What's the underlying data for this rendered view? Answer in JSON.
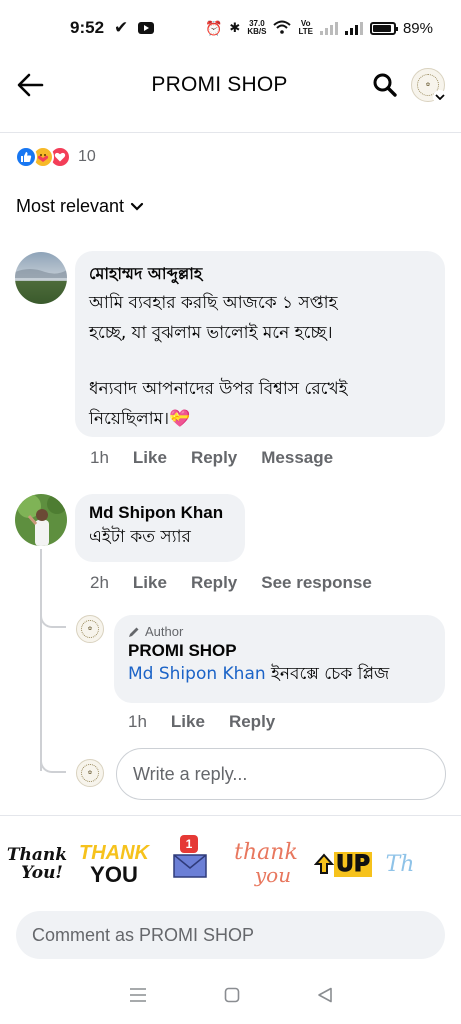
{
  "status_bar": {
    "time": "9:52",
    "net_speed_top": "37.0",
    "net_speed_bottom": "KB/S",
    "volte_top": "Vo",
    "volte_bottom": "LTE",
    "battery": "89%",
    "battery_level": 0.89
  },
  "header": {
    "title": "PROMI SHOP"
  },
  "reactions": {
    "count": "10"
  },
  "sort": {
    "label": "Most relevant"
  },
  "comments": [
    {
      "name": "মোহাম্মদ আব্দুল্লাহ",
      "text_line1": "আমি ব্যবহার করছি আজকে ১ সপ্তাহ",
      "text_line2": "হচ্ছে, যা বুঝলাম ভালোই মনে হচ্ছে।",
      "text_line3": "ধন্যবাদ আপনাদের উপর বিশ্বাস রেখেই",
      "text_line4": "নিয়েছিলাম।💝",
      "time": "1h",
      "like": "Like",
      "reply": "Reply",
      "extra": "Message"
    },
    {
      "name": "Md Shipon Khan",
      "text_line1": "এইটা কত স্যার",
      "time": "2h",
      "like": "Like",
      "reply": "Reply",
      "extra": "See response",
      "reply_item": {
        "tag": "Author",
        "name": "PROMI SHOP",
        "mention": "Md Shipon Khan",
        "text": " ইনবক্সে চেক প্লিজ",
        "time": "1h",
        "like": "Like",
        "reply": "Reply"
      }
    }
  ],
  "reply_input": {
    "placeholder": "Write a reply..."
  },
  "stickers": {
    "thank_you_1_line1": "Thank",
    "thank_you_1_line2": "You!",
    "thank_you_2_line1": "THANK",
    "thank_you_2_line2": "YOU",
    "mail_badge": "1",
    "thank_you_3_line1": "thank",
    "thank_you_3_line2": "you",
    "up_text": "UP",
    "partial": "Th"
  },
  "comment_box": {
    "placeholder": "Comment as PROMI SHOP"
  },
  "colors": {
    "accent": "#1877f2",
    "mention": "#1b63c7",
    "bubble": "#f0f2f5",
    "secondary_text": "#65676b"
  }
}
